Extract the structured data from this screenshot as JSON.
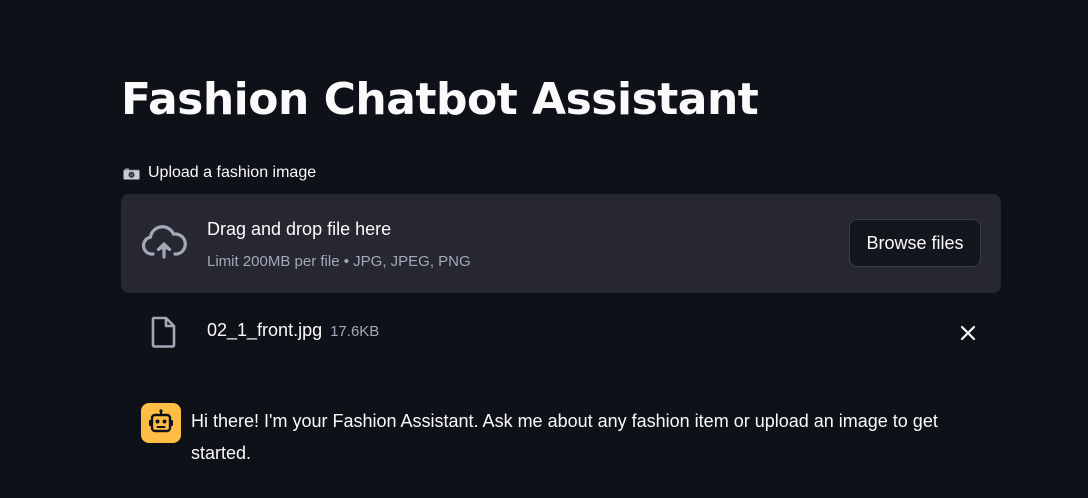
{
  "app": {
    "title": "Fashion Chatbot Assistant"
  },
  "uploader": {
    "label": "Upload a fashion image",
    "label_icon": "camera-icon",
    "dropzone_title": "Drag and drop file here",
    "dropzone_subtitle": "Limit 200MB per file • JPG, JPEG, PNG",
    "browse_label": "Browse files",
    "dropzone_icon": "cloud-upload-icon"
  },
  "uploaded_file": {
    "name": "02_1_front.jpg",
    "size": "17.6KB",
    "icon": "file-icon"
  },
  "chat": {
    "avatar_icon": "robot-icon",
    "message": "Hi there! I'm your Fashion Assistant. Ask me about any fashion item or upload an image to get started."
  },
  "colors": {
    "background": "#0e1117",
    "dropzone": "#262730",
    "avatar": "#ffbd45",
    "text": "#fafafa",
    "muted_text": "#a3a8b8"
  }
}
